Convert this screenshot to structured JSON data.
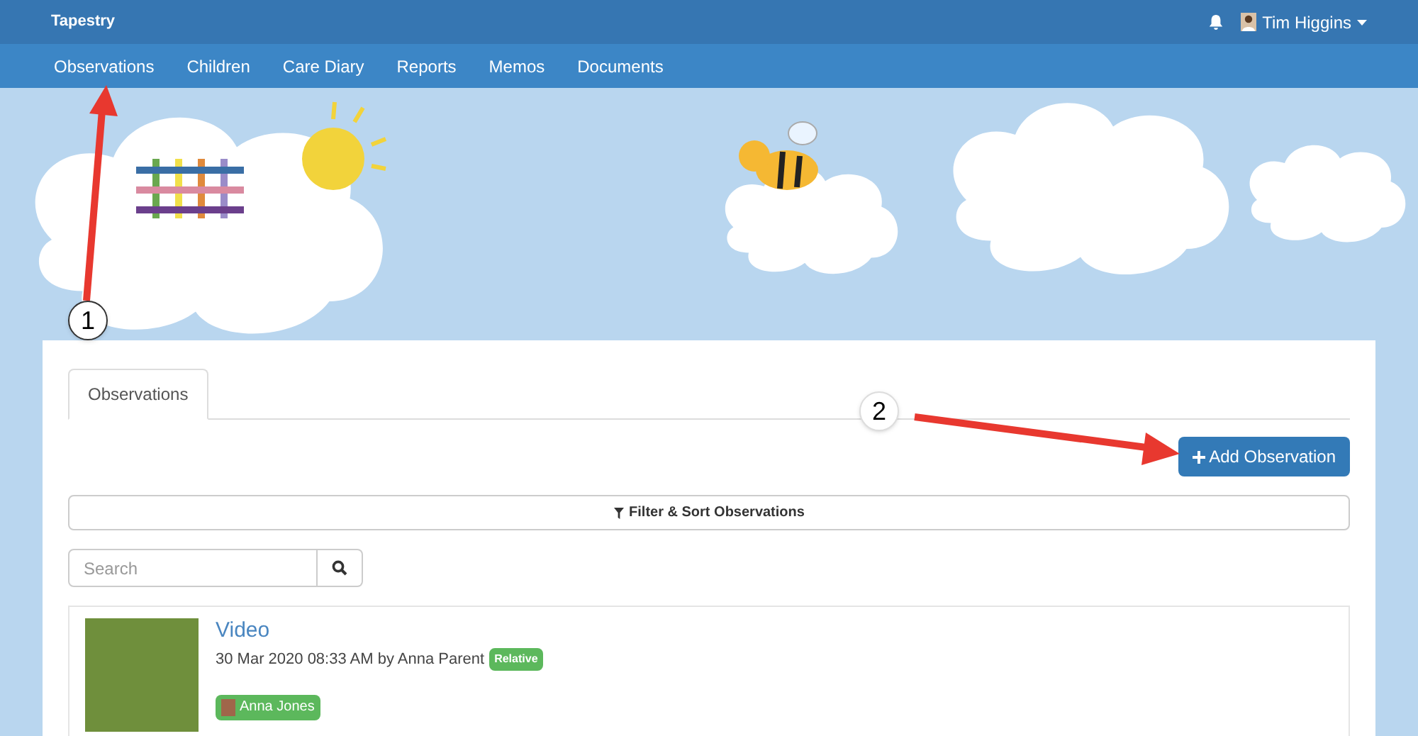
{
  "topbar": {
    "brand": "Tapestry",
    "user_name": "Tim Higgins"
  },
  "nav": [
    {
      "label": "Observations"
    },
    {
      "label": "Children"
    },
    {
      "label": "Care Diary"
    },
    {
      "label": "Reports"
    },
    {
      "label": "Memos"
    },
    {
      "label": "Documents"
    }
  ],
  "tabs": [
    {
      "label": "Observations",
      "selected": true
    }
  ],
  "add_button": "Add Observation",
  "filter_button": "Filter & Sort Observations",
  "search": {
    "placeholder": "Search"
  },
  "observations": [
    {
      "title": "Video",
      "meta": "30 Mar 2020 08:33 AM by Anna Parent",
      "role_badge": "Relative",
      "tagged_children": [
        "Anna Jones"
      ]
    }
  ],
  "annotations": [
    {
      "number": "1"
    },
    {
      "number": "2"
    }
  ]
}
